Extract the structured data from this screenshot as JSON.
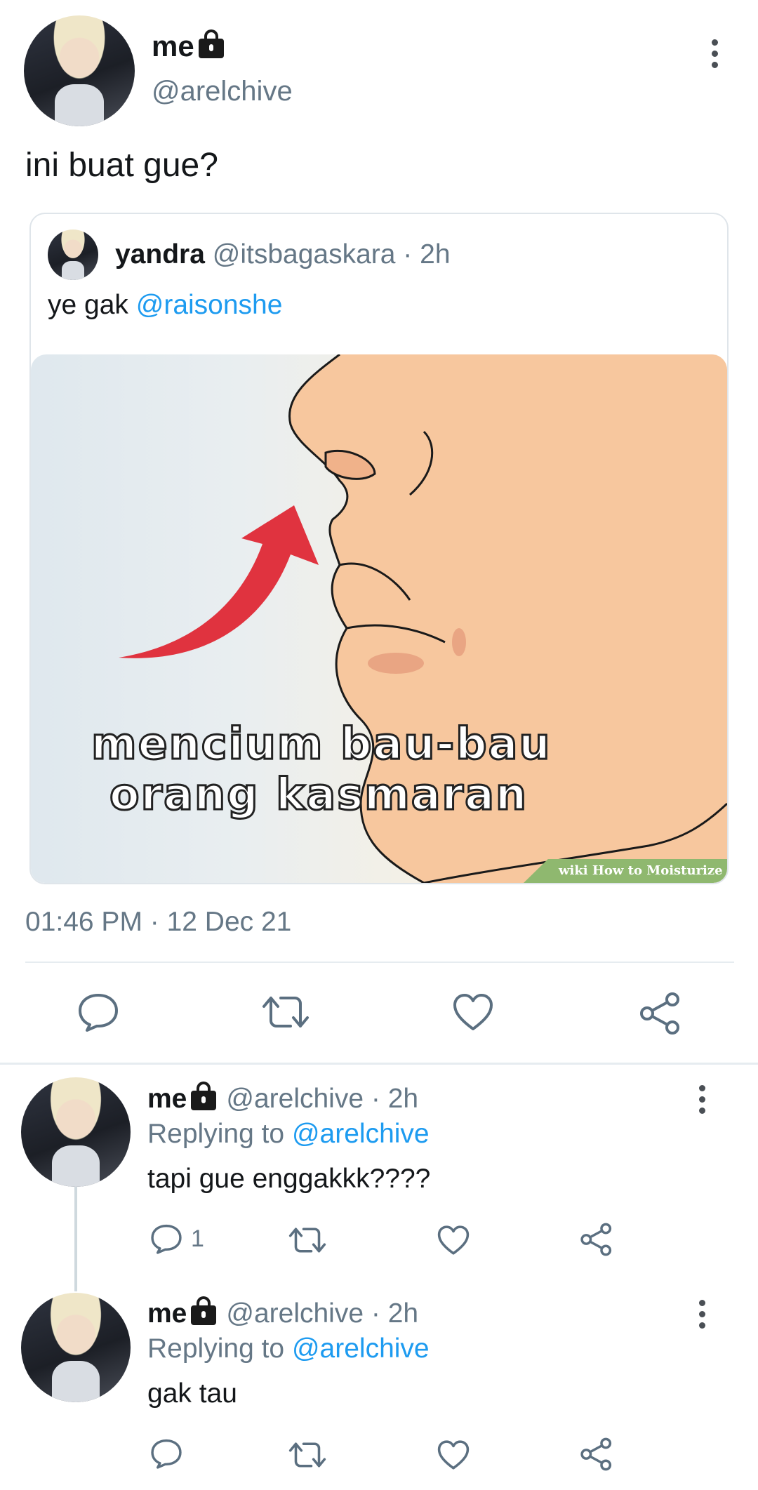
{
  "tweet": {
    "author_name": "me",
    "author_handle": "@arelchive",
    "text": "ini buat gue?",
    "timestamp": "01:46 PM · 12 Dec 21"
  },
  "quote": {
    "author_name": "yandra",
    "author_handle": "@itsbagaskara",
    "time": " · 2h",
    "text_prefix": "ye gak ",
    "mention": "@raisonshe",
    "image": {
      "caption_line1": "mencium bau-bau",
      "caption_line2": "orang kasmaran",
      "watermark": "wiki How to Moisturize Lip"
    }
  },
  "actions": [
    "reply-icon",
    "retweet-icon",
    "like-icon",
    "share-icon"
  ],
  "replies": [
    {
      "author_name": "me",
      "author_handle": "@arelchive · 2h",
      "replying_label": "Replying to ",
      "replying_to": "@arelchive",
      "text": "tapi gue enggakkk????",
      "reply_count": "1"
    },
    {
      "author_name": "me",
      "author_handle": "@arelchive · 2h",
      "replying_label": "Replying to ",
      "replying_to": "@arelchive",
      "text": "gak tau",
      "reply_count": ""
    }
  ],
  "colors": {
    "link": "#1d9bf0",
    "muted": "#657786",
    "icon": "#5b6f80"
  }
}
